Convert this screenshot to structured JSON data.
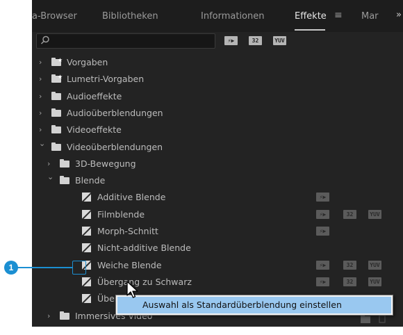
{
  "tabs": [
    {
      "label": "a-Browser",
      "active": false
    },
    {
      "label": "Bibliotheken",
      "active": false
    },
    {
      "label": "Informationen",
      "active": false
    },
    {
      "label": "Effekte",
      "active": true
    },
    {
      "label": "Mar",
      "active": false
    }
  ],
  "tab_menu_icon": "hamburger-menu-icon",
  "tab_overflow": "»",
  "search": {
    "value": "",
    "placeholder": "",
    "icon": "search-icon"
  },
  "filter_buttons": [
    {
      "name": "accelerated-effects-filter",
      "text": "⚡▶"
    },
    {
      "name": "32-bit-filter",
      "text": "32"
    },
    {
      "name": "yuv-filter",
      "text": "YUV"
    }
  ],
  "tree": [
    {
      "label": "Vorgaben",
      "type": "preset-folder",
      "expanded": false,
      "indent": 0
    },
    {
      "label": "Lumetri-Vorgaben",
      "type": "preset-folder",
      "expanded": false,
      "indent": 0
    },
    {
      "label": "Audioeffekte",
      "type": "folder",
      "expanded": false,
      "indent": 0
    },
    {
      "label": "Audioüberblendungen",
      "type": "folder",
      "expanded": false,
      "indent": 0
    },
    {
      "label": "Videoeffekte",
      "type": "folder",
      "expanded": false,
      "indent": 0
    },
    {
      "label": "Videoüberblendungen",
      "type": "folder",
      "expanded": true,
      "indent": 0
    },
    {
      "label": "3D-Bewegung",
      "type": "folder",
      "expanded": false,
      "indent": 1
    },
    {
      "label": "Blende",
      "type": "folder",
      "expanded": true,
      "indent": 1
    },
    {
      "label": "Additive Blende",
      "type": "effect",
      "indent": 2,
      "badges": {
        "accel": true,
        "b32": false,
        "yuv": false
      }
    },
    {
      "label": "Filmblende",
      "type": "effect",
      "indent": 2,
      "badges": {
        "accel": true,
        "b32": true,
        "yuv": true
      }
    },
    {
      "label": "Morph-Schnitt",
      "type": "effect",
      "indent": 2,
      "badges": {
        "accel": true,
        "b32": false,
        "yuv": false
      }
    },
    {
      "label": "Nicht-additive Blende",
      "type": "effect",
      "indent": 2,
      "badges": {
        "accel": false,
        "b32": false,
        "yuv": false
      }
    },
    {
      "label": "Weiche Blende",
      "type": "effect",
      "indent": 2,
      "badges": {
        "accel": true,
        "b32": true,
        "yuv": true
      }
    },
    {
      "label": "Übergang zu Schwarz",
      "type": "effect",
      "indent": 2,
      "badges": {
        "accel": true,
        "b32": true,
        "yuv": true
      }
    },
    {
      "label": "Über",
      "type": "effect",
      "indent": 2,
      "badges": {
        "accel": false,
        "b32": false,
        "yuv": false
      }
    },
    {
      "label": "Immersives Video",
      "type": "folder",
      "expanded": false,
      "indent": 1
    }
  ],
  "context_menu": {
    "items": [
      "Auswahl als Standardüberblendung einstellen"
    ]
  },
  "callout": {
    "number": "1",
    "color": "#1b8fd2"
  },
  "footer_icons": [
    "new-bin-icon",
    "trash-icon"
  ],
  "colors": {
    "panel_bg": "#232323",
    "tab_bg": "#1d1d1d",
    "text": "#bcbcbc",
    "highlight": "#99c8f0"
  }
}
